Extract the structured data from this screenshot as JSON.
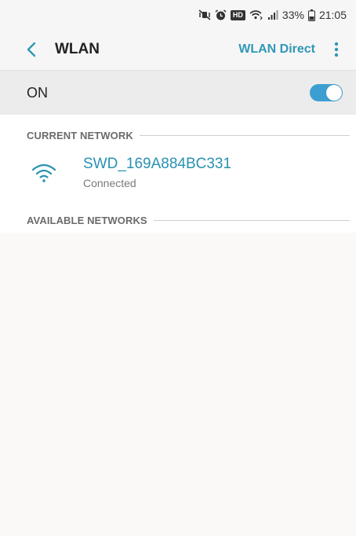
{
  "status_bar": {
    "icons": [
      "mute-vibrate-icon",
      "alarm-icon",
      "hd-badge",
      "wifi-calling-icon",
      "cell-signal-icon",
      "battery-icon"
    ],
    "hd_label": "HD",
    "battery_percent": "33%",
    "time": "21:05"
  },
  "app_bar": {
    "title": "WLAN",
    "action_label": "WLAN Direct",
    "back_icon": "chevron-left-icon",
    "more_icon": "more-vertical-icon"
  },
  "toggle": {
    "label": "ON",
    "state": true,
    "accent_color": "#3d9fd1"
  },
  "current_network": {
    "section_title": "CURRENT NETWORK",
    "ssid": "SWD_169A884BC331",
    "status": "Connected",
    "icon": "wifi-icon",
    "accent_color": "#2892b2"
  },
  "available_networks": {
    "section_title": "AVAILABLE NETWORKS",
    "items": []
  }
}
